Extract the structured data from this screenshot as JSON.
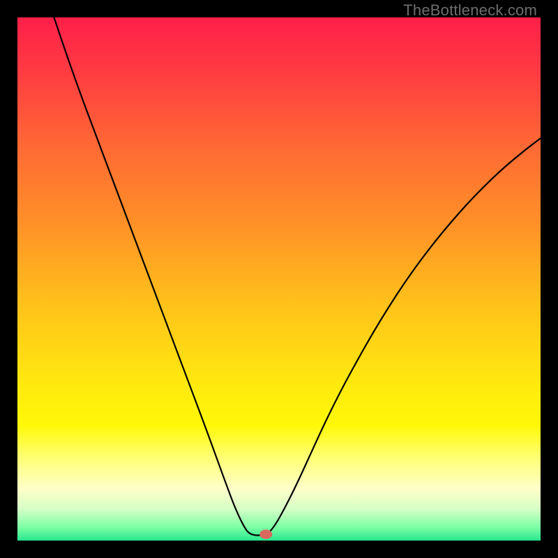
{
  "watermark": "TheBottleneck.com",
  "chart_data": {
    "type": "line",
    "title": "",
    "xlabel": "",
    "ylabel": "",
    "xlim": [
      0,
      100
    ],
    "ylim": [
      0,
      100
    ],
    "grid": false,
    "legend": false,
    "background_gradient": {
      "stops": [
        {
          "offset": 0.0,
          "color": "#ff1f49"
        },
        {
          "offset": 0.1,
          "color": "#ff3a42"
        },
        {
          "offset": 0.25,
          "color": "#ff6a34"
        },
        {
          "offset": 0.4,
          "color": "#ff9227"
        },
        {
          "offset": 0.55,
          "color": "#ffc21a"
        },
        {
          "offset": 0.7,
          "color": "#ffe90f"
        },
        {
          "offset": 0.78,
          "color": "#fff808"
        },
        {
          "offset": 0.84,
          "color": "#ffff72"
        },
        {
          "offset": 0.9,
          "color": "#ffffc8"
        },
        {
          "offset": 0.94,
          "color": "#d5ffc6"
        },
        {
          "offset": 0.975,
          "color": "#7bffa4"
        },
        {
          "offset": 1.0,
          "color": "#28e690"
        }
      ]
    },
    "series": [
      {
        "name": "bottleneck-curve",
        "stroke": "#000000",
        "stroke_width": 2.2,
        "points": [
          {
            "x": 7.0,
            "y": 100.0
          },
          {
            "x": 9.0,
            "y": 94.0
          },
          {
            "x": 12.0,
            "y": 85.5
          },
          {
            "x": 15.0,
            "y": 77.5
          },
          {
            "x": 18.0,
            "y": 69.5
          },
          {
            "x": 21.0,
            "y": 61.5
          },
          {
            "x": 24.0,
            "y": 53.5
          },
          {
            "x": 27.0,
            "y": 45.5
          },
          {
            "x": 30.0,
            "y": 37.5
          },
          {
            "x": 33.0,
            "y": 29.5
          },
          {
            "x": 36.0,
            "y": 21.5
          },
          {
            "x": 38.0,
            "y": 16.0
          },
          {
            "x": 40.0,
            "y": 10.5
          },
          {
            "x": 41.5,
            "y": 6.5
          },
          {
            "x": 43.0,
            "y": 3.2
          },
          {
            "x": 44.4,
            "y": 1.0
          },
          {
            "x": 47.5,
            "y": 1.0
          },
          {
            "x": 49.0,
            "y": 2.5
          },
          {
            "x": 51.0,
            "y": 6.0
          },
          {
            "x": 53.5,
            "y": 11.0
          },
          {
            "x": 56.0,
            "y": 16.5
          },
          {
            "x": 59.0,
            "y": 23.0
          },
          {
            "x": 62.0,
            "y": 29.0
          },
          {
            "x": 65.0,
            "y": 34.5
          },
          {
            "x": 68.0,
            "y": 39.8
          },
          {
            "x": 71.0,
            "y": 44.7
          },
          {
            "x": 74.0,
            "y": 49.3
          },
          {
            "x": 77.0,
            "y": 53.5
          },
          {
            "x": 80.0,
            "y": 57.4
          },
          {
            "x": 83.0,
            "y": 61.0
          },
          {
            "x": 86.0,
            "y": 64.4
          },
          {
            "x": 89.0,
            "y": 67.5
          },
          {
            "x": 92.0,
            "y": 70.4
          },
          {
            "x": 95.0,
            "y": 73.0
          },
          {
            "x": 98.0,
            "y": 75.4
          },
          {
            "x": 100.0,
            "y": 76.9
          }
        ]
      }
    ],
    "marker": {
      "name": "optimal-point",
      "x": 47.5,
      "y": 1.2,
      "rx": 1.2,
      "ry": 0.9,
      "color": "#d9685f"
    }
  }
}
